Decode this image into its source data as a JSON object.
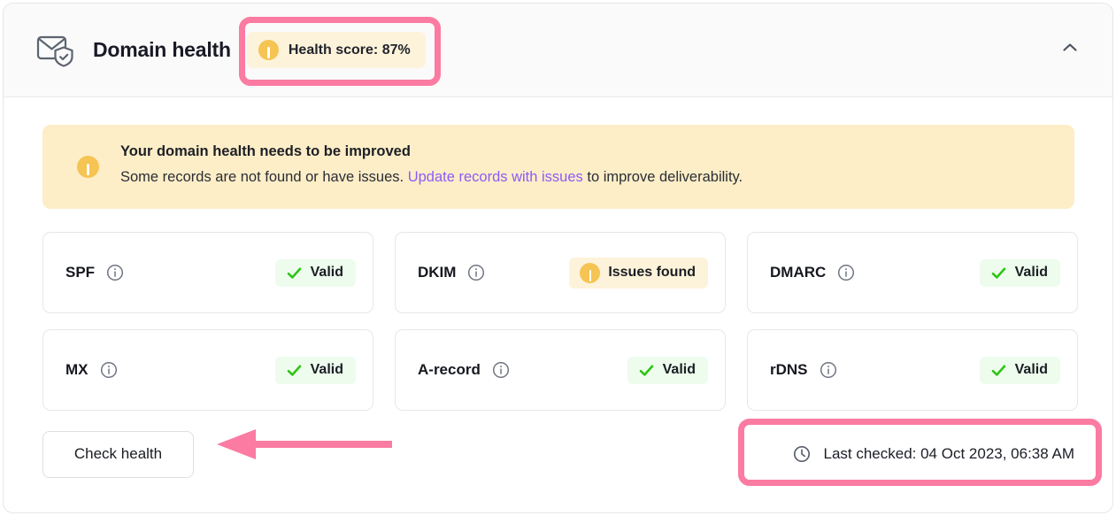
{
  "header": {
    "icon": "mail-shield-icon",
    "title": "Domain health",
    "score_badge": {
      "icon": "warning-circle-icon",
      "label": "Health score: 87%"
    },
    "collapse_icon": "chevron-up-icon"
  },
  "alert": {
    "icon": "warning-circle-icon",
    "title": "Your domain health needs to be improved",
    "desc_before": "Some records are not found or have issues.",
    "link": "Update records with issues",
    "desc_after": "to improve deliverability."
  },
  "records": [
    {
      "name": "SPF",
      "info_icon": "info-icon",
      "status": "Valid",
      "state": "valid",
      "status_icon": "check-icon"
    },
    {
      "name": "DKIM",
      "info_icon": "info-icon",
      "status": "Issues found",
      "state": "issues",
      "status_icon": "warning-circle-icon"
    },
    {
      "name": "DMARC",
      "info_icon": "info-icon",
      "status": "Valid",
      "state": "valid",
      "status_icon": "check-icon"
    },
    {
      "name": "MX",
      "info_icon": "info-icon",
      "status": "Valid",
      "state": "valid",
      "status_icon": "check-icon"
    },
    {
      "name": "A-record",
      "info_icon": "info-icon",
      "status": "Valid",
      "state": "valid",
      "status_icon": "check-icon"
    },
    {
      "name": "rDNS",
      "info_icon": "info-icon",
      "status": "Valid",
      "state": "valid",
      "status_icon": "check-icon"
    }
  ],
  "footer": {
    "check_health_label": "Check health",
    "clock_icon": "clock-icon",
    "last_checked": "Last checked: 04 Oct 2023, 06:38 AM"
  },
  "annotations": {
    "color": "#fb7ba2",
    "highlight_score": "health-score-badge",
    "highlight_last_checked": "last-checked",
    "arrow_points_to": "check-health-button"
  },
  "colors": {
    "warning_amber": "#f5c453",
    "warning_bg": "#fdf3da",
    "alert_bg": "#fdeec8",
    "valid_green": "#2ec413",
    "valid_bg": "#edfced",
    "link_purple": "#8b5cf6",
    "annotation_pink": "#fb7ba2"
  }
}
